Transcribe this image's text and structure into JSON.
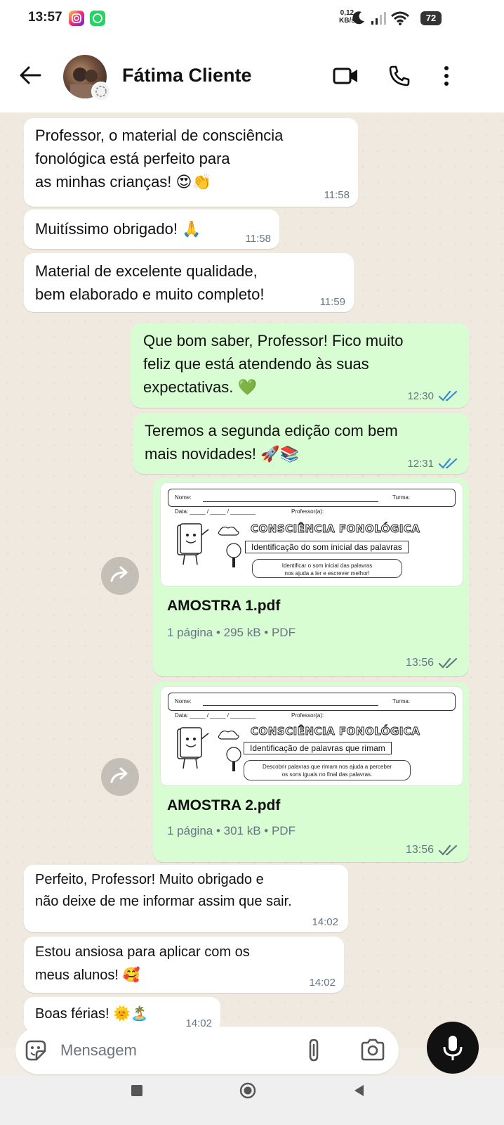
{
  "status_bar": {
    "time": "13:57",
    "net_speed_value": "0,12",
    "net_speed_unit": "KB/s",
    "battery": "72",
    "icons": [
      "instagram-icon",
      "whatsapp-icon",
      "moon-icon",
      "signal-icon",
      "wifi-icon",
      "battery-icon"
    ]
  },
  "header": {
    "contact_name": "Fátima Cliente",
    "icons": [
      "back-arrow-icon",
      "video-call-icon",
      "phone-icon",
      "more-vert-icon"
    ]
  },
  "messages": [
    {
      "direction": "in",
      "text": "Professor, o material de  consciência\nfonológica está perfeito para\nas minhas crianças!",
      "emoji": "😍👏",
      "time": "11:58"
    },
    {
      "direction": "in",
      "text": "Muitíssimo obrigado!",
      "emoji": "🙏",
      "time": "11:58"
    },
    {
      "direction": "in",
      "text": "Material de excelente qualidade,\nbem elaborado e muito completo!",
      "emoji": "",
      "time": "11:59"
    },
    {
      "direction": "out",
      "text": "Que bom saber, Professor! Fico muito\nfeliz que está atendendo às suas\nexpectativas.",
      "emoji": "💚",
      "time": "12:30",
      "status": "read"
    },
    {
      "direction": "out",
      "text": "Teremos a segunda edição com bem\nmais novidades!",
      "emoji": "🚀📚",
      "time": "12:31",
      "status": "read"
    },
    {
      "direction": "out",
      "type": "document",
      "file_name": "AMOSTRA 1.pdf",
      "meta": "1 página • 295 kB • PDF",
      "time": "13:56",
      "status": "delivered",
      "preview": {
        "nome": "Nome:",
        "turma": "Turma:",
        "data": "Data: _____ / _____ / ________",
        "professor": "Professor(a):",
        "title": "CONSCIÊNCIA FONOLÓGICA",
        "subtitle": "Identificação do som inicial das palavras",
        "box": "Identificar o som inicial das palavras\nnos ajuda a ler e escrever melhor!"
      }
    },
    {
      "direction": "out",
      "type": "document",
      "file_name": "AMOSTRA 2.pdf",
      "meta": "1 página • 301 kB • PDF",
      "time": "13:56",
      "status": "delivered",
      "preview": {
        "nome": "Nome:",
        "turma": "Turma:",
        "data": "Data: _____ / _____ / ________",
        "professor": "Professor(a):",
        "title": "CONSCIÊNCIA FONOLÓGICA",
        "subtitle": "Identificação de palavras que rimam",
        "box": "Descobrir palavras que rimam nos ajuda a perceber\nos sons iguais no final das palavras."
      }
    },
    {
      "direction": "in",
      "text": "Perfeito, Professor! Muito obrigado e\nnão deixe de me informar assim que sair.",
      "emoji": "",
      "time": "14:02"
    },
    {
      "direction": "in",
      "text": "Estou ansiosa para aplicar com os\nmeus alunos!",
      "emoji": "🥰",
      "time": "14:02"
    },
    {
      "direction": "in",
      "text": "Boas férias!",
      "emoji": "🌞🏝️",
      "time": "14:02"
    }
  ],
  "input": {
    "placeholder": "Mensagem",
    "icons": [
      "sticker-icon",
      "attach-icon",
      "camera-icon",
      "mic-icon"
    ]
  },
  "nav": {
    "icons": [
      "recents-icon",
      "home-icon",
      "back-triangle-icon"
    ]
  },
  "colors": {
    "incoming_bubble": "#ffffff",
    "outgoing_bubble": "#d9fdd3",
    "read_ticks": "#3b8ad9",
    "delivered_ticks": "#667781",
    "chat_background": "#efe9df"
  }
}
